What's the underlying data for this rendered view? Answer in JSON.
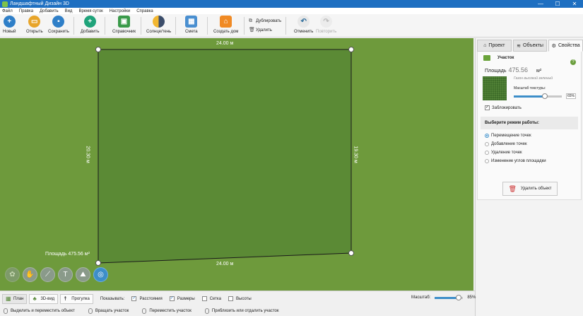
{
  "window": {
    "title": "Ландшафтный Дизайн 3D",
    "minimize": "—",
    "maximize": "☐",
    "close": "✕"
  },
  "menu": [
    "Файл",
    "Правка",
    "Добавить",
    "Вид",
    "Время суток",
    "Настройки",
    "Справка"
  ],
  "toolbar": {
    "new": "Новый",
    "open": "Открыть",
    "save": "Сохранить",
    "add": "Добавить",
    "reference": "Справочник",
    "sun_shade": "Солнце/тень",
    "estimate": "Смета",
    "create_house": "Создать дом",
    "duplicate": "Дублировать",
    "delete": "Удалить",
    "undo": "Отменить",
    "redo": "Повторить"
  },
  "plot": {
    "top_len": "24.00 м",
    "bottom_len": "24.00 м",
    "left_len": "20.30 м",
    "right_len": "19.30 м",
    "area_label": "Площадь 475.56  м²"
  },
  "panel": {
    "tabs": [
      "Проект",
      "Объекты",
      "Свойства"
    ],
    "object": "Участок",
    "help": "?",
    "area_label": "Площадь",
    "area_value": "475.56",
    "area_unit": "м²",
    "texture_name": "Газон высокий зеленый",
    "texture_scale_label": "Масштаб текстуры:",
    "texture_scale": "65%",
    "texture_scale_fraction": 0.65,
    "lock_label": "Заблокировать",
    "lock_checked": true,
    "mode_header": "Выберите режим работы:",
    "modes": [
      "Перемещение точек",
      "Добавление точек",
      "Удаление точек",
      "Изменение углов площадки"
    ],
    "selected_mode": 0,
    "delete_button": "Удалить объект"
  },
  "viewbar": {
    "plan": "План",
    "view3d": "3D-вид",
    "walk": "Прогулка",
    "show_label": "Показывать:",
    "options": [
      {
        "label": "Расстояния",
        "checked": true
      },
      {
        "label": "Размеры",
        "checked": true
      },
      {
        "label": "Сетка",
        "checked": false
      },
      {
        "label": "Высоты",
        "checked": false
      }
    ],
    "zoom_label": "Масштаб:",
    "zoom_value": "85%",
    "zoom_fraction": 0.85
  },
  "status": [
    "Выделить и переместить объект",
    "Вращать участок",
    "Переместить участок",
    "Приблизить или отдалить участок"
  ],
  "colors": {
    "grass": "#6e9a3c",
    "plot": "#5b8a35",
    "accent": "#3d8ec9",
    "titlebar": "#1e6fc1"
  }
}
